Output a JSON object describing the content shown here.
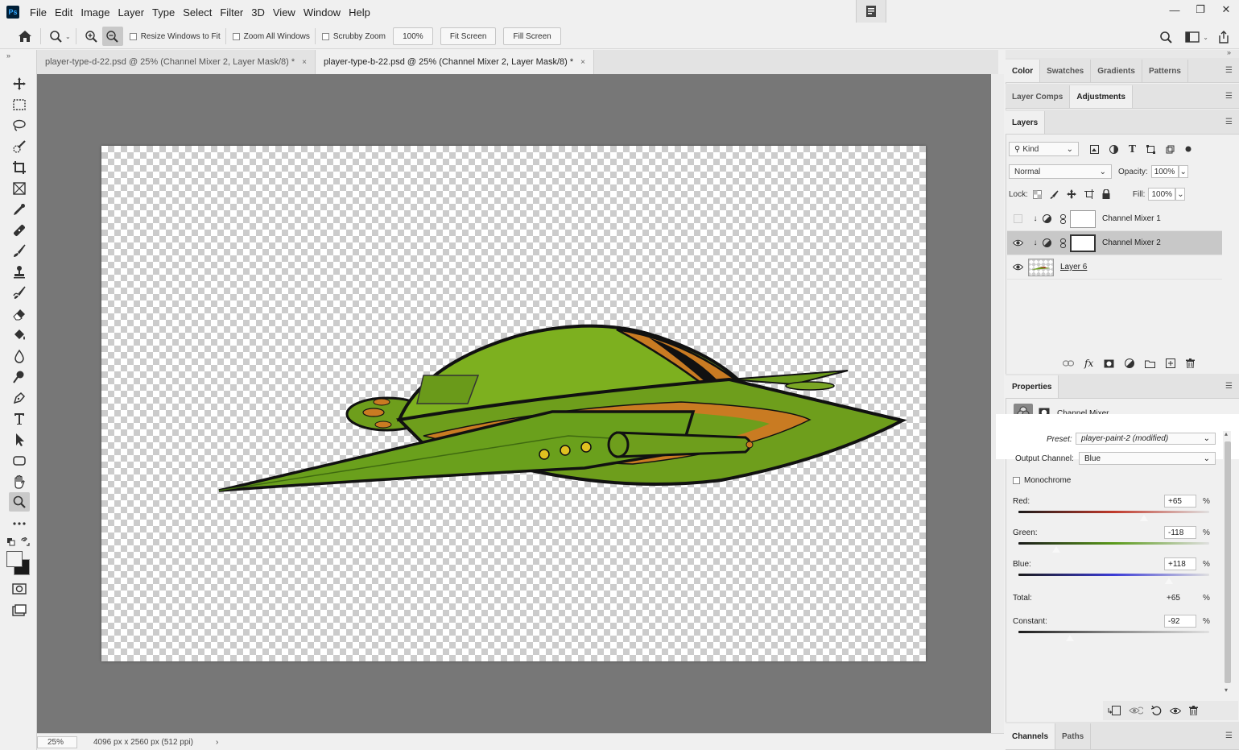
{
  "app": {
    "logo": "Ps"
  },
  "menu": [
    "File",
    "Edit",
    "Image",
    "Layer",
    "Type",
    "Select",
    "Filter",
    "3D",
    "View",
    "Window",
    "Help"
  ],
  "window_controls": {
    "minimize": "—",
    "restore": "❐",
    "close": "✕"
  },
  "options": {
    "resize_windows": "Resize Windows to Fit",
    "zoom_all": "Zoom All Windows",
    "scrubby_zoom": "Scrubby Zoom",
    "zoom_value": "100%",
    "fit_screen": "Fit Screen",
    "fill_screen": "Fill Screen"
  },
  "tabs": [
    {
      "label": "player-type-d-22.psd @ 25% (Channel Mixer 2, Layer Mask/8) *",
      "close": "×"
    },
    {
      "label": "player-type-b-22.psd @ 25% (Channel Mixer 2, Layer Mask/8) *",
      "close": "×"
    }
  ],
  "status": {
    "zoom": "25%",
    "doc_info": "4096 px x 2560 px (512 ppi)",
    "arrow": "›"
  },
  "panels": {
    "row1": [
      "Color",
      "Swatches",
      "Gradients",
      "Patterns"
    ],
    "row2": [
      "Layer Comps",
      "Adjustments"
    ],
    "row3": [
      "Layers"
    ],
    "props_tab": "Properties",
    "bottom": [
      "Channels",
      "Paths"
    ]
  },
  "layers": {
    "filter_kind": "Kind",
    "blend_mode": "Normal",
    "opacity_label": "Opacity:",
    "opacity": "100%",
    "lock_label": "Lock:",
    "fill_label": "Fill:",
    "fill": "100%",
    "items": [
      {
        "name": "Channel Mixer 1",
        "visible": false,
        "selected": false
      },
      {
        "name": "Channel Mixer 2",
        "visible": true,
        "selected": true
      },
      {
        "name": "Layer 6",
        "visible": true,
        "selected": false
      }
    ]
  },
  "properties": {
    "title": "Channel Mixer",
    "preset_label": "Preset:",
    "preset": "player-paint-2 (modified)",
    "output_label": "Output Channel:",
    "output": "Blue",
    "monochrome": "Monochrome",
    "red_label": "Red:",
    "red": "+65",
    "red_fraction": 0.66,
    "green_label": "Green:",
    "green": "-118",
    "green_fraction": 0.2,
    "blue_label": "Blue:",
    "blue": "+118",
    "blue_fraction": 0.79,
    "total_label": "Total:",
    "total": "+65",
    "constant_label": "Constant:",
    "constant": "-92",
    "constant_fraction": 0.27,
    "pct": "%"
  },
  "colors": {
    "accent_red": "#c0392b",
    "accent_green": "#5a9a1a",
    "accent_blue": "#3b3bd6",
    "ship_green": "#6e9e1c",
    "ship_orange": "#c97b22"
  }
}
